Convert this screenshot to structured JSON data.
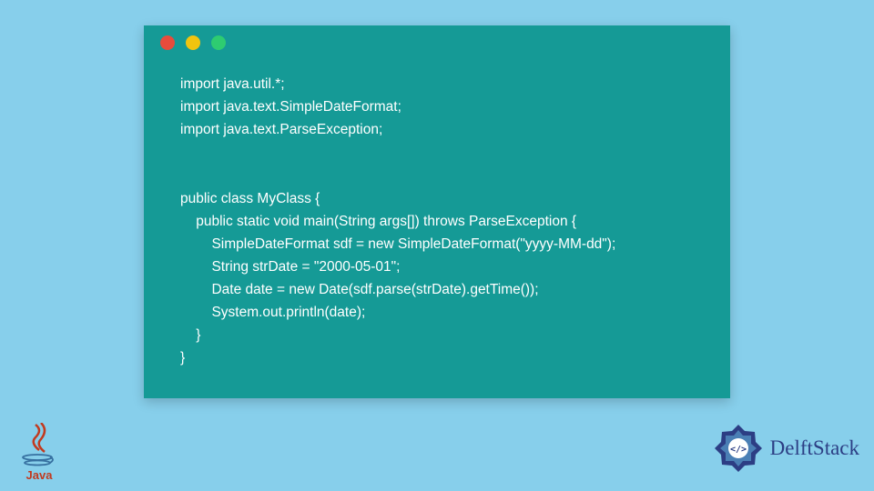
{
  "window": {
    "dots": [
      "red",
      "yellow",
      "green"
    ]
  },
  "code": {
    "lines": [
      "import java.util.*;",
      "import java.text.SimpleDateFormat;",
      "import java.text.ParseException;",
      "",
      "",
      "public class MyClass {",
      "    public static void main(String args[]) throws ParseException {",
      "        SimpleDateFormat sdf = new SimpleDateFormat(\"yyyy-MM-dd\");",
      "        String strDate = \"2000-05-01\";",
      "        Date date = new Date(sdf.parse(strDate).getTime());",
      "        System.out.println(date);",
      "    }",
      "}"
    ]
  },
  "footer": {
    "java_label": "Java",
    "brand_name": "DelftStack"
  },
  "colors": {
    "background": "#87cfeb",
    "code_bg": "#159a96",
    "code_text": "#ffffff",
    "java_red": "#c23a1f",
    "delft_blue": "#2c3e84"
  }
}
